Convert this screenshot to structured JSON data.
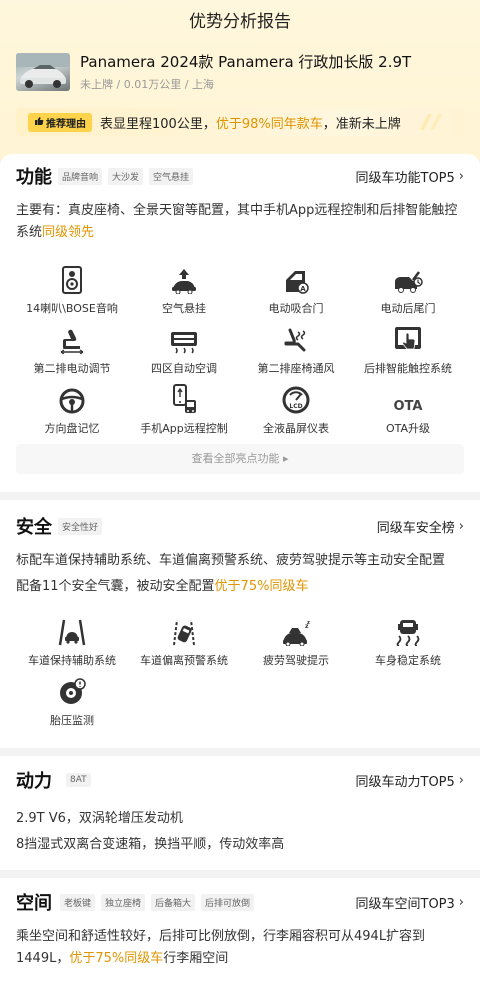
{
  "page_title": "优势分析报告",
  "car": {
    "name": "Panamera 2024款 Panamera 行政加长版 2.9T",
    "meta": "未上牌 / 0.01万公里 / 上海"
  },
  "recommend": {
    "badge": "推荐理由",
    "text_a": "表显里程100公里，",
    "text_hl": "优于98%同年款车",
    "text_b": "，准新未上牌"
  },
  "function": {
    "title": "功能",
    "tags": [
      "品牌音响",
      "大沙发",
      "空气悬挂"
    ],
    "link": "同级车功能TOP5",
    "desc_a": "主要有：真皮座椅、全景天窗等配置，其中手机App远程控制和后排智能触控系统",
    "desc_hl": "同级领先",
    "features": [
      {
        "label": "14喇叭\\BOSE音响",
        "icon": "speaker-icon"
      },
      {
        "label": "空气悬挂",
        "icon": "air-suspension-icon"
      },
      {
        "label": "电动吸合门",
        "icon": "soft-close-door-icon"
      },
      {
        "label": "电动后尾门",
        "icon": "power-tailgate-icon"
      },
      {
        "label": "第二排电动调节",
        "icon": "power-seat-icon"
      },
      {
        "label": "四区自动空调",
        "icon": "climate-control-icon"
      },
      {
        "label": "第二排座椅通风",
        "icon": "seat-ventilation-icon"
      },
      {
        "label": "后排智能触控系统",
        "icon": "touch-control-icon"
      },
      {
        "label": "方向盘记忆",
        "icon": "steering-wheel-icon"
      },
      {
        "label": "手机App远程控制",
        "icon": "phone-remote-icon"
      },
      {
        "label": "全液晶屏仪表",
        "icon": "lcd-gauge-icon"
      },
      {
        "label": "OTA升级",
        "icon": "ota-icon"
      }
    ],
    "view_all": "查看全部亮点功能 ▸",
    "ota_text": "OTA"
  },
  "safety": {
    "title": "安全",
    "tags": [
      "安全性好"
    ],
    "link": "同级车安全榜",
    "desc1": "标配车道保持辅助系统、车道偏离预警系统、疲劳驾驶提示等主动安全配置",
    "desc2_a": "配备11个安全气囊，被动安全配置",
    "desc2_hl": "优于75%同级车",
    "features": [
      {
        "label": "车道保持辅助系统",
        "icon": "lane-keep-icon"
      },
      {
        "label": "车道偏离预警系统",
        "icon": "lane-departure-icon"
      },
      {
        "label": "疲劳驾驶提示",
        "icon": "fatigue-alert-icon"
      },
      {
        "label": "车身稳定系统",
        "icon": "stability-control-icon"
      },
      {
        "label": "胎压监测",
        "icon": "tire-pressure-icon"
      }
    ]
  },
  "power": {
    "title": "动力",
    "tags": [
      "8AT"
    ],
    "link": "同级车动力TOP5",
    "desc1": "2.9T V6，双涡轮增压发动机",
    "desc2": "8挡湿式双离合变速箱，换挡平顺，传动效率高"
  },
  "space": {
    "title": "空间",
    "tags": [
      "老板键",
      "独立座椅",
      "后备箱大",
      "后排可放倒"
    ],
    "link": "同级车空间TOP3",
    "desc_a": "乘坐空间和舒适性较好，后排可比例放倒，行李厢容积可从494L扩容到1449L，",
    "desc_hl": "优于75%同级车",
    "desc_b": "行李厢空间"
  },
  "colors": {
    "accent": "#e09400",
    "header_bg": "#fff6dc",
    "badge": "#ffd34a"
  }
}
